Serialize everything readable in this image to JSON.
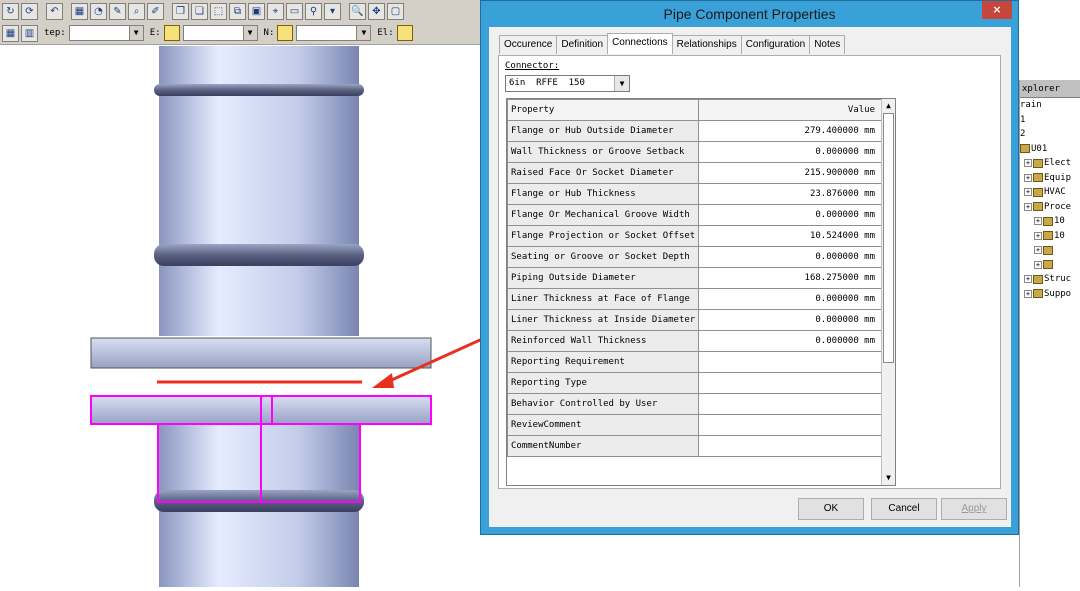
{
  "toolbar": {
    "row1_icons": [
      "rotate-icon",
      "refresh-icon",
      "undo-icon",
      "grid-icon",
      "measure-icon",
      "edit-icon",
      "zoom-icon",
      "pen-icon",
      "copy-icon",
      "paste-icon",
      "select-icon",
      "clip-icon",
      "view-icon",
      "nav-icon",
      "window-icon",
      "filter-icon",
      "dropdown-icon",
      "search-icon",
      "move-icon",
      "box-icon"
    ],
    "step_label": "tep:",
    "e_label": "E:",
    "n_label": "N:",
    "el_label": "El:"
  },
  "dialog": {
    "title": "Pipe Component Properties",
    "close": "×",
    "tabs": [
      "Occurence",
      "Definition",
      "Connections",
      "Relationships",
      "Configuration",
      "Notes"
    ],
    "active_tab": "Connections",
    "connector_label": "Connector:",
    "connector_value": "6in  RFFE  150",
    "grid_header": {
      "property": "Property",
      "value": "Value"
    },
    "rows": [
      {
        "property": "Flange or Hub Outside Diameter",
        "value": "279.400000 mm"
      },
      {
        "property": "Wall Thickness or Groove Setback",
        "value": "0.000000 mm"
      },
      {
        "property": "Raised Face Or Socket Diameter",
        "value": "215.900000 mm"
      },
      {
        "property": "Flange or Hub Thickness",
        "value": "23.876000 mm"
      },
      {
        "property": "Flange Or Mechanical Groove Width",
        "value": "0.000000 mm"
      },
      {
        "property": "Flange Projection or Socket Offset",
        "value": "10.524000 mm"
      },
      {
        "property": "Seating or Groove or Socket Depth",
        "value": "0.000000 mm"
      },
      {
        "property": "Piping Outside Diameter",
        "value": "168.275000 mm"
      },
      {
        "property": "Liner Thickness at Face of Flange",
        "value": "0.000000 mm"
      },
      {
        "property": "Liner Thickness at Inside Diameter",
        "value": "0.000000 mm"
      },
      {
        "property": "Reinforced Wall Thickness",
        "value": "0.000000 mm"
      },
      {
        "property": "Reporting Requirement",
        "value": ""
      },
      {
        "property": "Reporting Type",
        "value": ""
      },
      {
        "property": "Behavior Controlled by User",
        "value": ""
      },
      {
        "property": "ReviewComment",
        "value": ""
      },
      {
        "property": "CommentNumber",
        "value": ""
      }
    ],
    "buttons": {
      "ok": "OK",
      "cancel": "Cancel",
      "apply": "Apply"
    }
  },
  "explorer": {
    "title": "xplorer",
    "items": [
      "rain",
      "1",
      "2",
      "U01",
      "Elect",
      "Equip",
      "HVAC",
      "Proce",
      "10",
      "10",
      "",
      "",
      "Struc",
      "Suppo"
    ]
  },
  "colors": {
    "highlight": "#ff00ff",
    "arrow": "#e8301e",
    "pipe": "#b8c4e8",
    "dialog_frame": "#3aa0d8"
  }
}
